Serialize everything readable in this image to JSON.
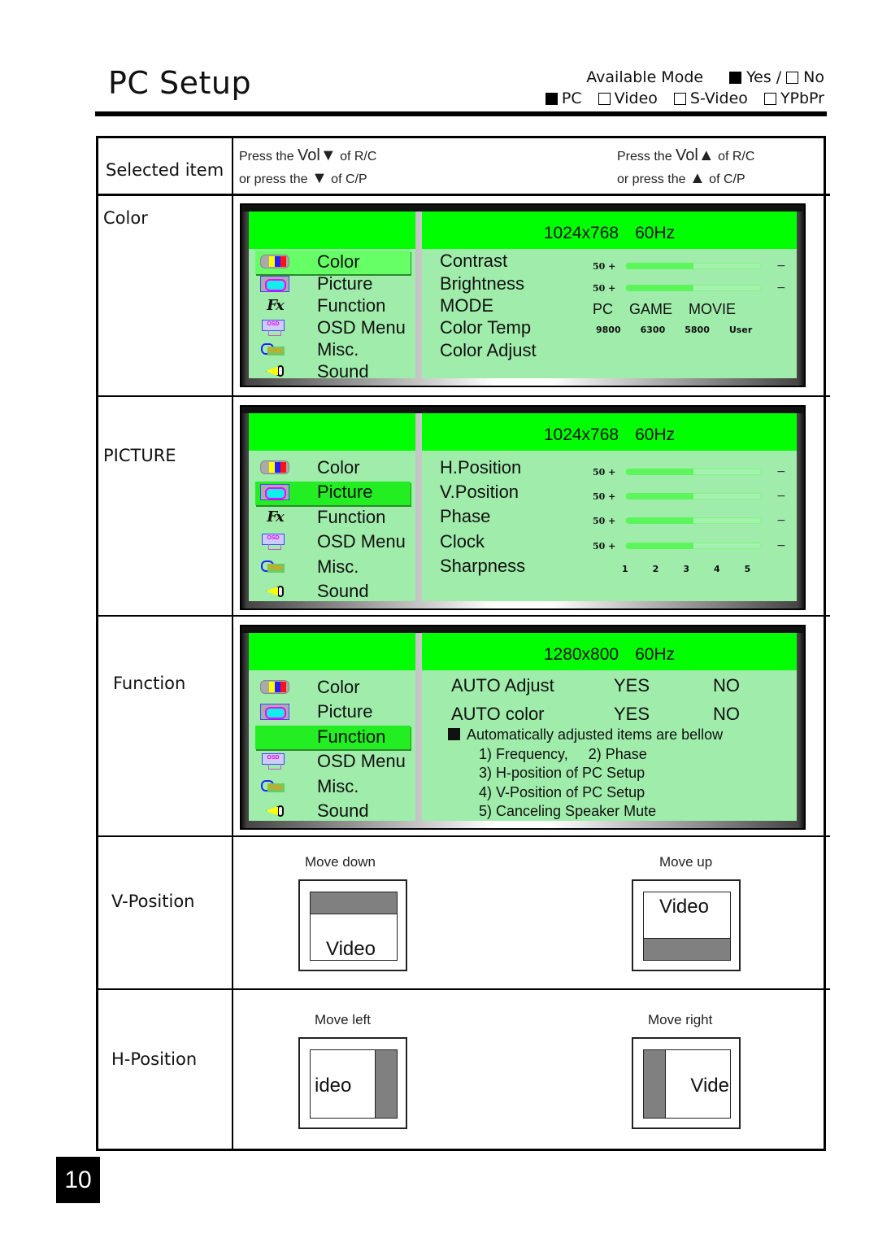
{
  "page": {
    "title": "PC Setup",
    "page_number": "10"
  },
  "available_mode": {
    "label": "Available Mode",
    "legend": [
      {
        "label": "Yes",
        "filled": true
      },
      {
        "label": "No",
        "filled": false
      }
    ],
    "legend_separator": "/",
    "modes": [
      {
        "label": "PC",
        "available": true
      },
      {
        "label": "Video",
        "available": false
      },
      {
        "label": "S-Video",
        "available": false
      },
      {
        "label": "YPbPr",
        "available": false
      }
    ]
  },
  "table_header": {
    "selected_item": "Selected item",
    "down_instruction": {
      "line1_pre": "Press the ",
      "line1_key": "Vol▼",
      "line1_post": " of R/C",
      "line2_pre": "or press the ",
      "line2_key": "▼",
      "line2_post": " of C/P"
    },
    "up_instruction": {
      "line1_pre": "Press the ",
      "line1_key": "Vol▲",
      "line1_post": " of R/C",
      "line2_pre": "or press the ",
      "line2_key": "▲",
      "line2_post": " of C/P"
    }
  },
  "menu_items": [
    {
      "label": "Color",
      "icon": "color-bars-icon"
    },
    {
      "label": "Picture",
      "icon": "picture-icon"
    },
    {
      "label": "Function",
      "icon": "fx-icon"
    },
    {
      "label": "OSD Menu",
      "icon": "osd-monitor-icon"
    },
    {
      "label": "Misc.",
      "icon": "misc-icon"
    },
    {
      "label": "Sound",
      "icon": "speaker-icon"
    }
  ],
  "rows": {
    "color": {
      "label": "Color",
      "resolution": "1024x768",
      "refresh": "60Hz",
      "selected_menu": "Color",
      "params": [
        {
          "label": "Contrast",
          "value": "50",
          "plus": "+",
          "minus": "−",
          "fill": 0.5
        },
        {
          "label": "Brightness",
          "value": "50",
          "plus": "+",
          "minus": "−",
          "fill": 0.5
        },
        {
          "label": "MODE",
          "options": [
            "PC",
            "GAME",
            "MOVIE"
          ]
        },
        {
          "label": "Color Temp",
          "options": [
            "9800",
            "6300",
            "5800",
            "User"
          ]
        },
        {
          "label": "Color Adjust"
        }
      ]
    },
    "picture": {
      "label": "PICTURE",
      "resolution": "1024x768",
      "refresh": "60Hz",
      "selected_menu": "Picture",
      "params": [
        {
          "label": "H.Position",
          "value": "50",
          "plus": "+",
          "minus": "−",
          "fill": 0.5
        },
        {
          "label": "V.Position",
          "value": "50",
          "plus": "+",
          "minus": "−",
          "fill": 0.5
        },
        {
          "label": "Phase",
          "value": "50",
          "plus": "+",
          "minus": "−",
          "fill": 0.5
        },
        {
          "label": "Clock",
          "value": "50",
          "plus": "+",
          "minus": "−",
          "fill": 0.5
        },
        {
          "label": "Sharpness",
          "options": [
            "1",
            "2",
            "3",
            "4",
            "5"
          ]
        }
      ]
    },
    "function": {
      "label": "Function",
      "resolution": "1280x800",
      "refresh": "60Hz",
      "selected_menu": "Function",
      "params": [
        {
          "label": "AUTO Adjust",
          "yes": "YES",
          "no": "NO"
        },
        {
          "label": "AUTO color",
          "yes": "YES",
          "no": "NO"
        }
      ],
      "note": "Automatically adjusted items are bellow",
      "note_items": [
        "1) Frequency,     2) Phase",
        "3) H-position of PC Setup",
        "4) V-Position of PC Setup",
        "5) Canceling Speaker Mute"
      ]
    },
    "v_position": {
      "label": "V-Position",
      "down_caption": "Move down",
      "up_caption": "Move up",
      "down_text": "Video",
      "up_text": "Video"
    },
    "h_position": {
      "label": "H-Position",
      "left_caption": "Move left",
      "right_caption": "Move right",
      "left_text": "ideo",
      "right_text": "Vide"
    }
  },
  "colors": {
    "osd_header": "#00ff00",
    "osd_body": "#a0ecab",
    "selected_item": "#66ff66",
    "shift_bar": "#808080"
  }
}
